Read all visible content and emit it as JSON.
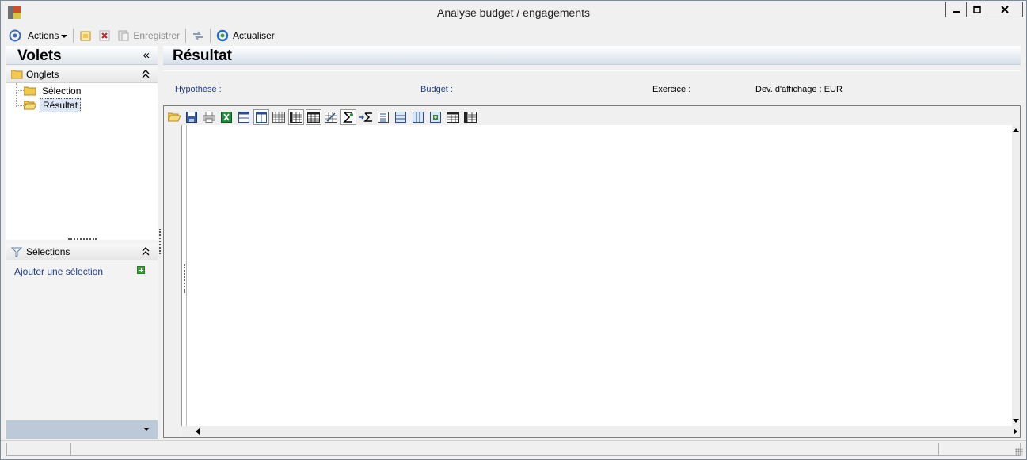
{
  "window": {
    "title": "Analyse budget / engagements",
    "buttons": [
      "minimize-icon",
      "maximize-icon",
      "close-icon"
    ]
  },
  "toolbar": {
    "actions_label": "Actions",
    "save_label": "Enregistrer",
    "refresh_label": "Actualiser",
    "icons": [
      "actions-icon",
      "new-icon",
      "delete-icon",
      "save-icon",
      "sync-icon",
      "refresh-icon"
    ]
  },
  "left_pane": {
    "title": "Volets",
    "collapse_glyph": "«",
    "onglets": {
      "title": "Onglets",
      "items": [
        {
          "label": "Sélection",
          "selected": false
        },
        {
          "label": "Résultat",
          "selected": true
        }
      ]
    },
    "selections": {
      "title": "Sélections",
      "add_link": "Ajouter une sélection"
    }
  },
  "main": {
    "title": "Résultat",
    "info": {
      "hypothese_label": "Hypothèse :",
      "budget_label": "Budget :",
      "exercice_label": "Exercice :",
      "devise_label": "Dev. d'affichage : EUR"
    },
    "grid_toolbar_icons": [
      "open-folder-icon",
      "save-icon",
      "print-icon",
      "excel-icon",
      "grid-single-icon",
      "columns-icon",
      "rows-icon",
      "table-icon",
      "table-grid-icon",
      "table-fill-icon",
      "filter-table-icon",
      "sum-icon",
      "insert-sum-icon",
      "list-icon",
      "merge-rows-icon",
      "split-columns-icon",
      "expand-icon",
      "collapse-icon",
      "freeze-icon"
    ]
  },
  "colors": {
    "link_blue": "#1a3a8a",
    "header_gradient_end": "#d6dfea",
    "pane_bottom": "#bcc9d8"
  }
}
